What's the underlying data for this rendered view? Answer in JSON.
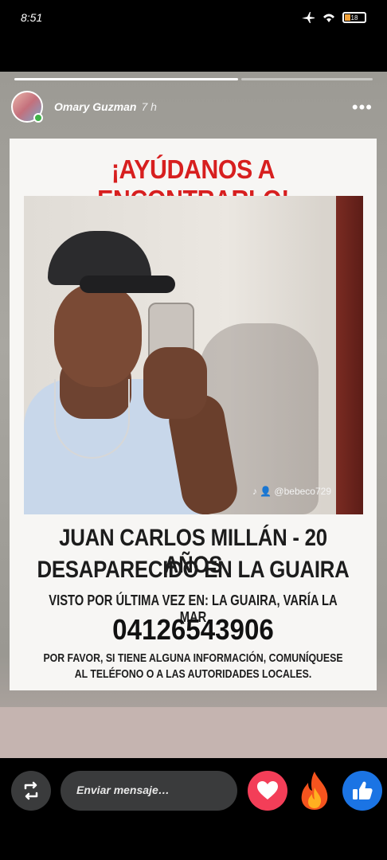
{
  "status_bar": {
    "time": "8:51",
    "battery": "18"
  },
  "story": {
    "username": "Omary Guzman",
    "time_ago": "7 h",
    "more": "•••"
  },
  "poster": {
    "title": "¡AYÚDANOS A ENCONTRARLO!",
    "photo_tag": "@bebeco729",
    "name_age": "JUAN CARLOS MILLÁN - 20 AÑOS",
    "missing_in": "DESAPARECIDO EN LA GUAIRA",
    "last_seen": "VISTO POR ÚLTIMA VEZ EN: LA GUAIRA, VARÍA LA MAR",
    "phone": "04126543906",
    "request_line1": "POR FAVOR, SI TIENE ALGUNA INFORMACIÓN, COMUNÍQUESE",
    "request_line2": "AL TELÉFONO O A LAS AUTORIDADES LOCALES."
  },
  "reply_bar": {
    "placeholder": "Enviar mensaje…",
    "reactions": [
      "heart-icon",
      "fire-icon",
      "like-icon"
    ]
  },
  "colors": {
    "title_red": "#d71f1f",
    "heart": "#f33e58",
    "like": "#1b74e4",
    "online": "#3fb24a"
  }
}
